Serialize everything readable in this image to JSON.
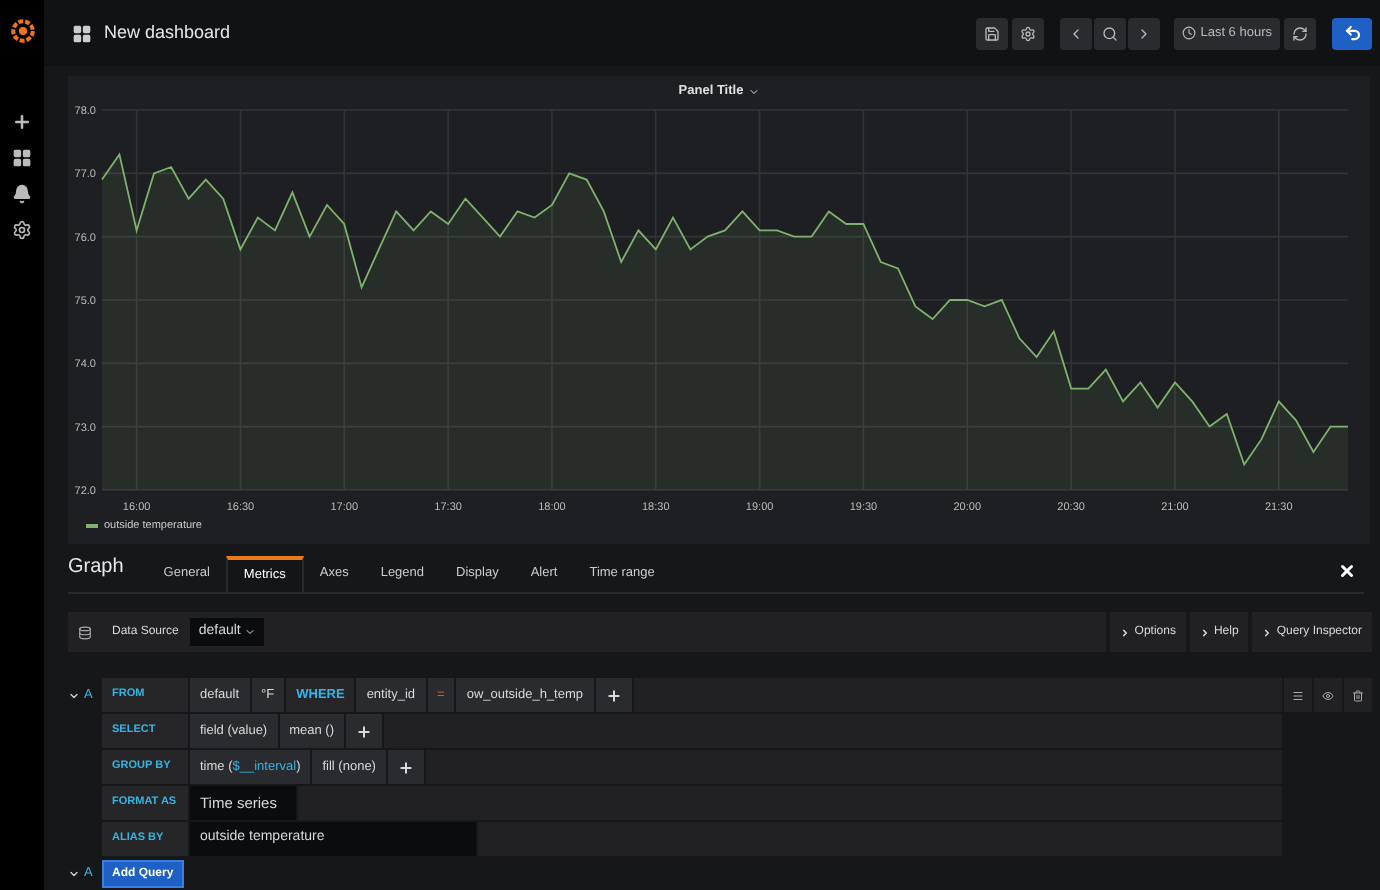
{
  "topbar": {
    "title": "New dashboard",
    "time_range": "Last 6 hours"
  },
  "panel": {
    "title": "Panel Title",
    "chart_data": {
      "type": "area",
      "grid": true,
      "x": [
        950,
        955,
        960,
        965,
        970,
        975,
        980,
        985,
        990,
        995,
        1000,
        1005,
        1010,
        1015,
        1020,
        1025,
        1030,
        1035,
        1040,
        1045,
        1050,
        1055,
        1060,
        1065,
        1070,
        1075,
        1080,
        1085,
        1090,
        1095,
        1100,
        1105,
        1110,
        1115,
        1120,
        1125,
        1130,
        1135,
        1140,
        1145,
        1150,
        1155,
        1160,
        1165,
        1170,
        1175,
        1180,
        1185,
        1190,
        1195,
        1200,
        1205,
        1210,
        1215,
        1220,
        1225,
        1230,
        1235,
        1240,
        1245,
        1250,
        1255,
        1260,
        1265,
        1270,
        1275,
        1280,
        1285,
        1290,
        1295,
        1300,
        1305,
        1310
      ],
      "series": [
        {
          "name": "outside temperature",
          "color": "#7eb26d",
          "values": [
            76.9,
            77.3,
            76.1,
            77.0,
            77.1,
            76.6,
            76.9,
            76.6,
            75.8,
            76.3,
            76.1,
            76.7,
            76.0,
            76.5,
            76.2,
            75.2,
            75.8,
            76.4,
            76.1,
            76.4,
            76.2,
            76.6,
            76.3,
            76.0,
            76.4,
            76.3,
            76.5,
            77.0,
            76.9,
            76.4,
            75.6,
            76.1,
            75.8,
            76.3,
            75.8,
            76.0,
            76.1,
            76.4,
            76.1,
            76.1,
            76.0,
            76.0,
            76.4,
            76.2,
            76.2,
            75.6,
            75.5,
            74.9,
            74.7,
            75.0,
            75.0,
            74.9,
            75.0,
            74.4,
            74.1,
            74.5,
            73.6,
            73.6,
            73.9,
            73.4,
            73.7,
            73.3,
            73.7,
            73.4,
            73.0,
            73.2,
            72.4,
            72.8,
            73.4,
            73.1,
            72.6,
            73.0,
            73.0
          ]
        }
      ],
      "xlim": [
        950,
        1310
      ],
      "ylim": [
        72,
        78
      ],
      "xticks": [
        {
          "value": 960,
          "label": "16:00"
        },
        {
          "value": 990,
          "label": "16:30"
        },
        {
          "value": 1020,
          "label": "17:00"
        },
        {
          "value": 1050,
          "label": "17:30"
        },
        {
          "value": 1080,
          "label": "18:00"
        },
        {
          "value": 1110,
          "label": "18:30"
        },
        {
          "value": 1140,
          "label": "19:00"
        },
        {
          "value": 1170,
          "label": "19:30"
        },
        {
          "value": 1200,
          "label": "20:00"
        },
        {
          "value": 1230,
          "label": "20:30"
        },
        {
          "value": 1260,
          "label": "21:00"
        },
        {
          "value": 1290,
          "label": "21:30"
        }
      ],
      "yticks": [
        {
          "value": 72,
          "label": "72.0"
        },
        {
          "value": 73,
          "label": "73.0"
        },
        {
          "value": 74,
          "label": "74.0"
        },
        {
          "value": 75,
          "label": "75.0"
        },
        {
          "value": 76,
          "label": "76.0"
        },
        {
          "value": 77,
          "label": "77.0"
        },
        {
          "value": 78,
          "label": "78.0"
        }
      ]
    }
  },
  "editor": {
    "title": "Graph",
    "tabs": [
      {
        "label": "General",
        "selected": false
      },
      {
        "label": "Metrics",
        "selected": true
      },
      {
        "label": "Axes",
        "selected": false
      },
      {
        "label": "Legend",
        "selected": false
      },
      {
        "label": "Display",
        "selected": false
      },
      {
        "label": "Alert",
        "selected": false
      },
      {
        "label": "Time range",
        "selected": false
      }
    ],
    "data_source": {
      "label": "Data Source",
      "value": "default"
    },
    "buttons": [
      "Options",
      "Help",
      "Query Inspector"
    ],
    "query": {
      "ref": "A",
      "rows": [
        {
          "label": "FROM",
          "items": [
            {
              "kind": "segment",
              "parts": [
                {
                  "text": "default"
                }
              ]
            },
            {
              "kind": "segment",
              "parts": [
                {
                  "text": "°F"
                }
              ]
            },
            {
              "kind": "keyword",
              "parts": [
                {
                  "text": "WHERE"
                }
              ]
            },
            {
              "kind": "segment",
              "parts": [
                {
                  "text": "entity_id"
                }
              ]
            },
            {
              "kind": "operator",
              "parts": [
                {
                  "text": "="
                }
              ]
            },
            {
              "kind": "segment",
              "parts": [
                {
                  "text": "ow_outside_h_temp"
                }
              ]
            },
            {
              "kind": "plus"
            }
          ]
        },
        {
          "label": "SELECT",
          "items": [
            {
              "kind": "segment",
              "parts": [
                {
                  "text": "field (value)"
                }
              ]
            },
            {
              "kind": "segment",
              "parts": [
                {
                  "text": "mean ()"
                }
              ]
            },
            {
              "kind": "plus"
            }
          ]
        },
        {
          "label": "GROUP BY",
          "items": [
            {
              "kind": "segment",
              "parts": [
                {
                  "text": "time ("
                },
                {
                  "text": "$__interval",
                  "param": true
                },
                {
                  "text": ")"
                }
              ]
            },
            {
              "kind": "segment",
              "parts": [
                {
                  "text": "fill (none)"
                }
              ]
            },
            {
              "kind": "plus"
            }
          ]
        },
        {
          "label": "FORMAT AS",
          "items": [
            {
              "kind": "select",
              "parts": [
                {
                  "text": "Time series"
                }
              ]
            }
          ]
        },
        {
          "label": "ALIAS BY",
          "items": [
            {
              "kind": "input",
              "parts": [
                {
                  "text": "outside temperature"
                }
              ]
            }
          ]
        }
      ]
    },
    "add": {
      "ref": "A",
      "button": "Add Query"
    }
  }
}
